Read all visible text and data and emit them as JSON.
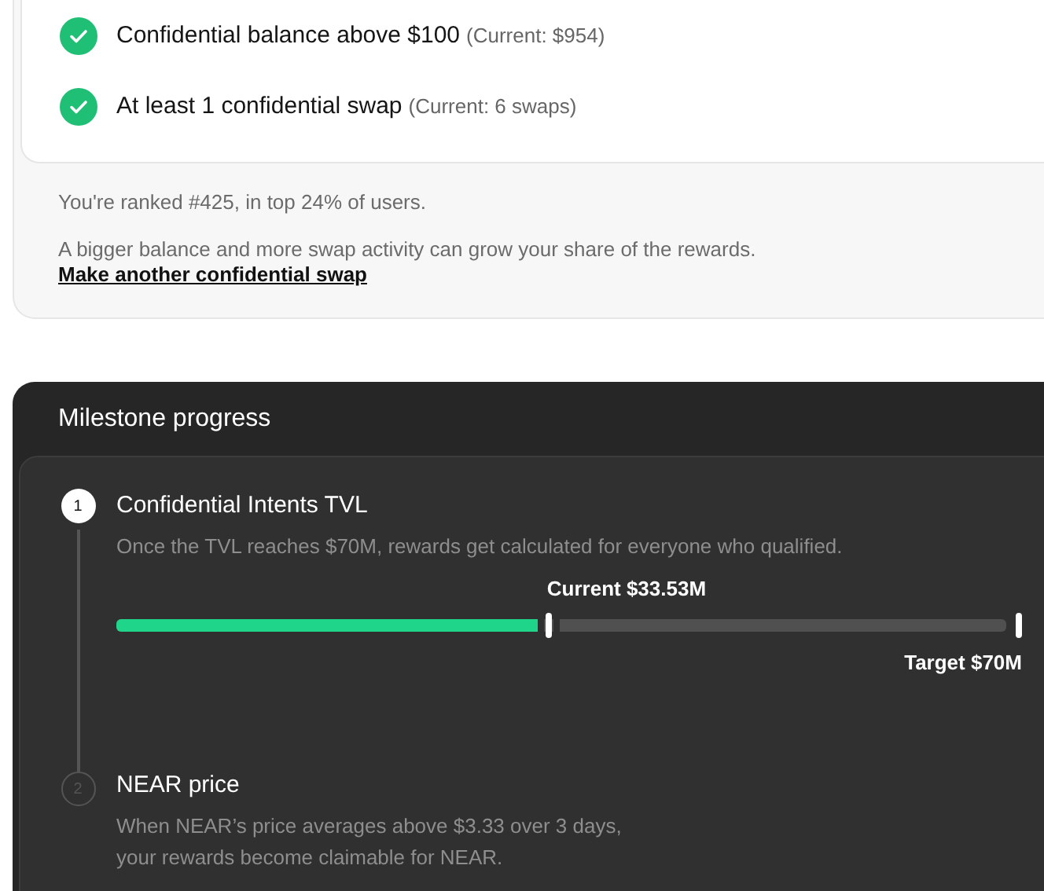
{
  "requirements": {
    "criteria": [
      {
        "label": "Confidential balance above $100",
        "current": "(Current: $954)",
        "met": true
      },
      {
        "label": "At least 1 confidential swap",
        "current": "(Current: 6 swaps)",
        "met": true
      }
    ],
    "rank_text": "You're ranked #425, in top 24% of users.",
    "hint": "A bigger balance and more swap activity can grow your share of the rewards.",
    "link": "Make another confidential swap"
  },
  "milestones": {
    "title": "Milestone progress",
    "steps": [
      {
        "number": "1",
        "title": "Confidential Intents TVL",
        "description": "Once the TVL reaches $70M, rewards get calculated for everyone who qualified.",
        "active": true,
        "progress": {
          "current_label": "Current $33.53M",
          "target_label": "Target $70M",
          "level": 0.479
        }
      },
      {
        "number": "2",
        "title": "NEAR price",
        "description": "When NEAR’s price averages above $3.33 over 3 days, your rewards become claimable for NEAR.",
        "active": false
      }
    ]
  }
}
